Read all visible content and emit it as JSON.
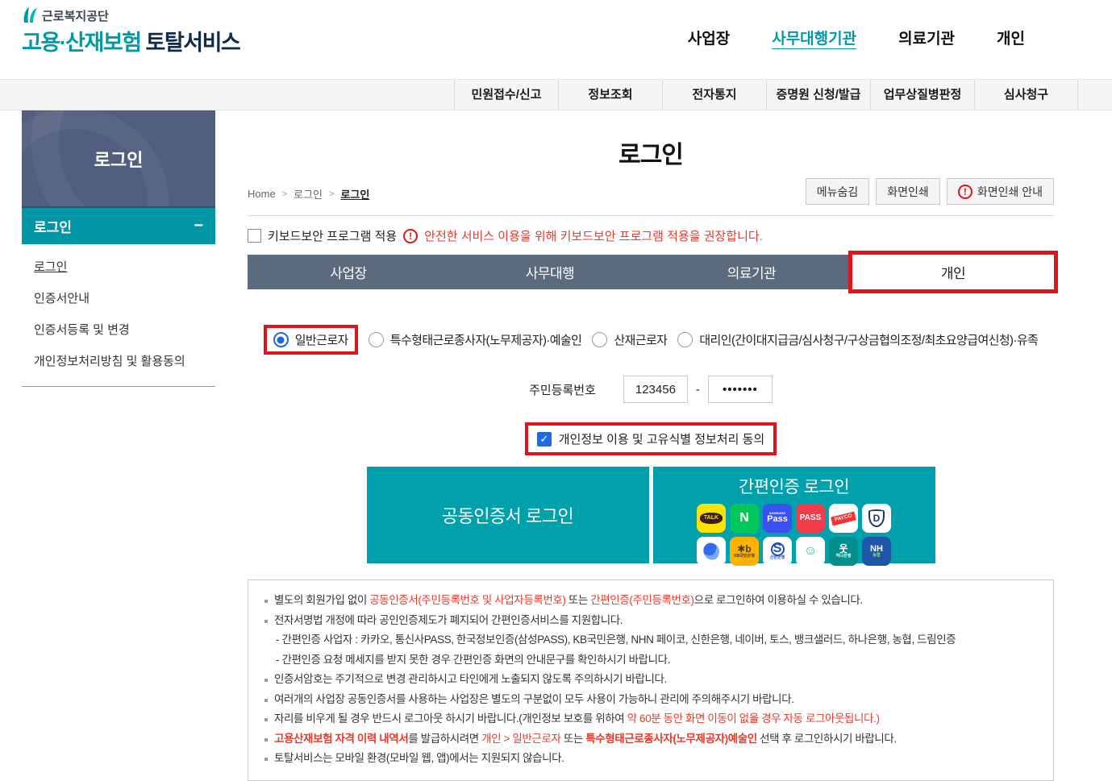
{
  "colors": {
    "teal": "#0099a8",
    "navy": "#0e2b4e",
    "slate_tab": "#5b6b7d",
    "side_navy": "#515e7d",
    "band_teal": "#0096a6",
    "button_teal": "#00a0ad",
    "annotation_red": "#e0151b",
    "note_red": "#e8392b"
  },
  "brand": {
    "org": "근로복지공단",
    "service_teal": "고용·산재보험",
    "service_dark": "토탈서비스"
  },
  "top_nav": {
    "items": [
      {
        "label": "사업장",
        "active": false
      },
      {
        "label": "사무대행기관",
        "active": true
      },
      {
        "label": "의료기관",
        "active": false
      },
      {
        "label": "개인",
        "active": false
      }
    ]
  },
  "gnb": {
    "items": [
      "민원접수/신고",
      "정보조회",
      "전자통지",
      "증명원 신청/발급",
      "업무상질병판정",
      "심사청구"
    ]
  },
  "sidebar": {
    "header": "로그인",
    "group": {
      "label": "로그인",
      "collapse": "−"
    },
    "items": [
      {
        "label": "로그인",
        "active": true
      },
      {
        "label": "인증서안내",
        "active": false
      },
      {
        "label": "인증서등록 및 변경",
        "active": false
      },
      {
        "label": "개인정보처리방침 및 활용동의",
        "active": false
      }
    ]
  },
  "page": {
    "title": "로그인",
    "breadcrumb": [
      "Home",
      "로그인",
      "로그인"
    ],
    "actions": [
      {
        "label": "메뉴숨김",
        "icon": ""
      },
      {
        "label": "화면인쇄",
        "icon": ""
      },
      {
        "label": "화면인쇄 안내",
        "icon": "warning"
      }
    ]
  },
  "keyboard_security": {
    "label": "키보드보안 프로그램 적용",
    "checked": false,
    "warning": "안전한 서비스 이용을 위해 키보드보안 프로그램 적용을 권장합니다."
  },
  "tabs": [
    {
      "label": "사업장",
      "active": false
    },
    {
      "label": "사무대행",
      "active": false
    },
    {
      "label": "의료기관",
      "active": false
    },
    {
      "label": "개인",
      "active": true,
      "annotated": true
    }
  ],
  "radios": [
    {
      "label": "일반근로자",
      "checked": true,
      "annotated": true
    },
    {
      "label": "특수형태근로종사자(노무제공자)·예술인",
      "checked": false,
      "annotated": false
    },
    {
      "label": "산재근로자",
      "checked": false,
      "annotated": false
    },
    {
      "label": "대리인(간이대지급금/심사청구/구상금협의조정/최초요양급여신청)·유족",
      "checked": false,
      "annotated": false
    }
  ],
  "rrn": {
    "label": "주민등록번호",
    "front_value": "123456",
    "separator": "-",
    "back_masked": "•••••••"
  },
  "consent": {
    "label": "개인정보 이용 및 고유식별 정보처리 동의",
    "checked": true,
    "check_glyph": "✓",
    "annotated": true
  },
  "login": {
    "cert_label": "공동인증서 로그인",
    "simple_title": "간편인증 로그인",
    "providers": [
      {
        "name": "kakaotalk-icon",
        "bg": "#fbe300",
        "fg": "#3a1d1d",
        "label": "TALK",
        "kind": "bubble"
      },
      {
        "name": "naver-icon",
        "bg": "#03c75a",
        "fg": "#ffffff",
        "label": "N",
        "size": 16,
        "kind": "text"
      },
      {
        "name": "samsung-pass-icon",
        "bg": "#3c4ff0",
        "fg": "#ffffff",
        "top": "SAMSUNG",
        "label": "Pass",
        "size": 11,
        "kind": "text"
      },
      {
        "name": "pass-icon",
        "bg": "#f23c4c",
        "fg": "#ffffff",
        "label": "PASS",
        "size": 10,
        "kind": "text"
      },
      {
        "name": "payco-icon",
        "bg": "#ffffff",
        "fg": "#ffffff",
        "label": "PAYCO",
        "kind": "ribbon"
      },
      {
        "name": "dream-security-icon",
        "bg": "#ffffff",
        "fg": "#23346c",
        "label": "D",
        "kind": "shield"
      },
      {
        "name": "toss-icon",
        "bg": "#ffffff",
        "fg": "#2f6df0",
        "label": "",
        "kind": "swirl"
      },
      {
        "name": "kb-kookmin-icon",
        "bg": "#ffb300",
        "fg": "#4a3a22",
        "label": "✱b",
        "size": 12,
        "sub": "KB국민은행",
        "subColor": "#4a3a22",
        "kind": "text"
      },
      {
        "name": "shinhan-icon",
        "bg": "#ffffff",
        "fg": "#1c4bc8",
        "label": "S",
        "size": 11,
        "sub": "신한은행",
        "subColor": "#1c4bc8",
        "kind": "circle"
      },
      {
        "name": "banksalad-icon",
        "bg": "#ffffff",
        "fg": "#00c4b3",
        "label": "☺",
        "size": 16,
        "kind": "text"
      },
      {
        "name": "hana-icon",
        "bg": "#008f8b",
        "fg": "#ffffff",
        "label": "웃",
        "size": 12,
        "sub": "하나은행",
        "subColor": "#ffffff",
        "kind": "text"
      },
      {
        "name": "nh-nonghyup-icon",
        "bg": "#2056a7",
        "fg": "#ffffff",
        "label": "NH",
        "size": 11,
        "sub": "농협",
        "subColor": "#9be56a",
        "kind": "text"
      }
    ]
  },
  "notes": [
    {
      "indent": false,
      "segments": [
        {
          "t": "별도의 회원가입 없이 "
        },
        {
          "t": "공동인증서(주민등록번호 및 사업자등록번호)",
          "s": "red"
        },
        {
          "t": " 또는 "
        },
        {
          "t": "간편인증(주민등록번호)",
          "s": "red"
        },
        {
          "t": "으로 로그인하여 이용하실 수 있습니다."
        }
      ]
    },
    {
      "indent": false,
      "segments": [
        {
          "t": "전자서명법 개정에 따라 공인인증제도가 폐지되어 간편인증서비스를 지원합니다."
        }
      ]
    },
    {
      "indent": true,
      "segments": [
        {
          "t": "- 간편인증 사업자 : 카카오, 통신사PASS, 한국정보인증(삼성PASS), KB국민은행, NHN 페이코, 신한은행, 네이버, 토스, 뱅크샐러드, 하나은행, 농협, 드림인증"
        }
      ]
    },
    {
      "indent": true,
      "segments": [
        {
          "t": "- 간편인증 요청 메세지를 받지 못한 경우 간편인증 화면의 안내문구를 확인하시기 바랍니다."
        }
      ]
    },
    {
      "indent": false,
      "segments": [
        {
          "t": "인증서암호는 주기적으로 변경 관리하시고 타인에게 노출되지 않도록 주의하시기 바랍니다."
        }
      ]
    },
    {
      "indent": false,
      "segments": [
        {
          "t": "여러개의 사업장 공동인증서를 사용하는 사업장은 별도의 구분없이 모두 사용이 가능하니 관리에 주의해주시기 바랍니다."
        }
      ]
    },
    {
      "indent": false,
      "segments": [
        {
          "t": "자리를 비우게 될 경우 반드시 로그아웃 하시기 바랍니다.(개인정보 보호를 위하여 "
        },
        {
          "t": "약 60분 동안 화면 이동이 없을 경우 자동 로그아웃됩니다.)",
          "s": "red"
        }
      ]
    },
    {
      "indent": false,
      "segments": [
        {
          "t": "고용산재보험 자격 이력 내역서",
          "s": "redbold"
        },
        {
          "t": "를 발급하시려면 "
        },
        {
          "t": "개인 > 일반근로자",
          "s": "red"
        },
        {
          "t": " 또는 "
        },
        {
          "t": "특수형태근로종사자(노무제공자)예술인",
          "s": "redbold"
        },
        {
          "t": " 선택 후 로그인하시기 바랍니다."
        }
      ]
    },
    {
      "indent": false,
      "segments": [
        {
          "t": "토탈서비스는 모바일 환경(모바일 웹, 앱)에서는 지원되지 않습니다."
        }
      ]
    }
  ]
}
